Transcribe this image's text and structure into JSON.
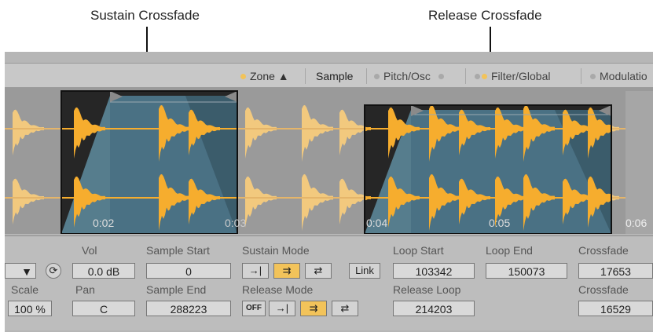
{
  "annotations": {
    "sustain": "Sustain Crossfade",
    "release": "Release Crossfade"
  },
  "tabs": {
    "zone": "Zone ▲",
    "sample": "Sample",
    "pitch": "Pitch/Osc",
    "filter": "Filter/Global",
    "modulation": "Modulatio"
  },
  "timeline": {
    "t1": "0:02",
    "t2": "0:03",
    "t3": "0:04",
    "t4": "0:05",
    "t5": "0:06"
  },
  "controls": {
    "vol_label": "Vol",
    "vol_value": "0.0 dB",
    "sample_start_label": "Sample Start",
    "sample_start_value": "0",
    "sustain_mode_label": "Sustain Mode",
    "link_label": "Link",
    "loop_start_label": "Loop Start",
    "loop_start_value": "103342",
    "loop_end_label": "Loop End",
    "loop_end_value": "150073",
    "crossfade_label": "Crossfade",
    "crossfade_value": "17653",
    "scale_label": "Scale",
    "scale_value": "100 %",
    "pan_label": "Pan",
    "pan_value": "C",
    "sample_end_label": "Sample End",
    "sample_end_value": "288223",
    "release_mode_label": "Release Mode",
    "release_off_label": "OFF",
    "release_loop_label": "Release Loop",
    "release_loop_value": "214203",
    "crossfade2_label": "Crossfade",
    "crossfade2_value": "16529",
    "icons": {
      "forward": "→|",
      "loop_forward": "⇉",
      "loop_backforth": "⇄"
    }
  },
  "colors": {
    "accent": "#f2c35a",
    "waveform": "#f6ad2e",
    "selection": "#4a7184"
  }
}
